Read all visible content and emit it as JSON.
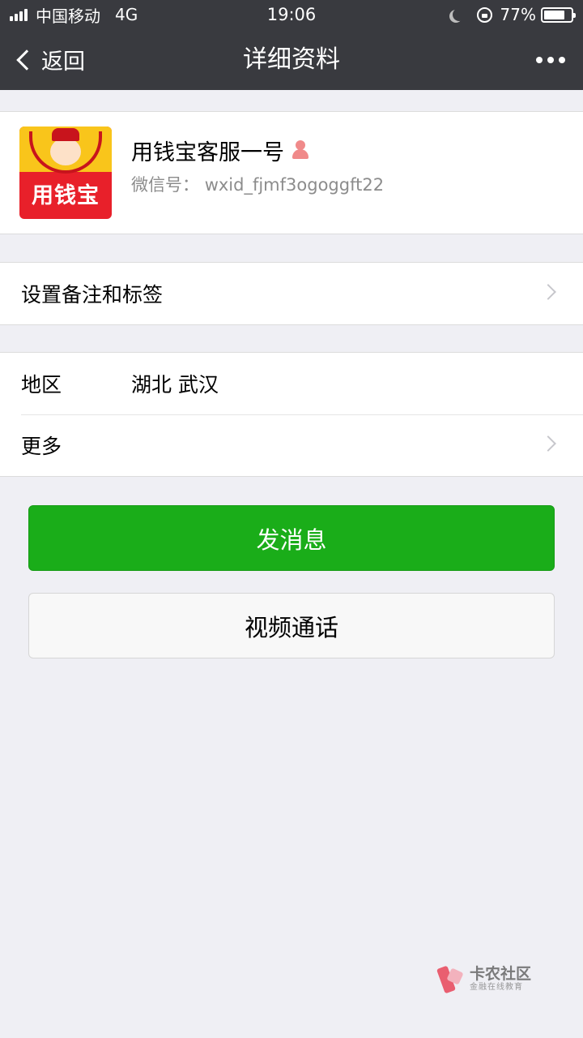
{
  "status_bar": {
    "carrier": "中国移动",
    "network": "4G",
    "time": "19:06",
    "battery_percent": "77%",
    "battery_level": 0.77,
    "signal_bars_filled": 4,
    "icons": [
      "signal-icon",
      "moon-icon",
      "rotation-lock-icon",
      "battery-icon"
    ]
  },
  "nav": {
    "back_label": "返回",
    "title": "详细资料",
    "more_icon": "more-dots-icon"
  },
  "profile": {
    "name": "用钱宝客服一号",
    "gender_icon": "female-icon",
    "wechat_id_label": "微信号：",
    "wechat_id": "wxid_fjmf3ogoggft22",
    "avatar_text": "用钱宝"
  },
  "remark": {
    "label": "设置备注和标签"
  },
  "info": {
    "region_label": "地区",
    "region_value": "湖北 武汉",
    "more_label": "更多"
  },
  "actions": {
    "send_message": "发消息",
    "video_call": "视频通话"
  },
  "colors": {
    "nav_background": "#393a3f",
    "primary_button": "#1aad19",
    "page_background": "#efeff4"
  },
  "watermark": {
    "name": "卡农社区",
    "tagline": "金融在线教育"
  }
}
